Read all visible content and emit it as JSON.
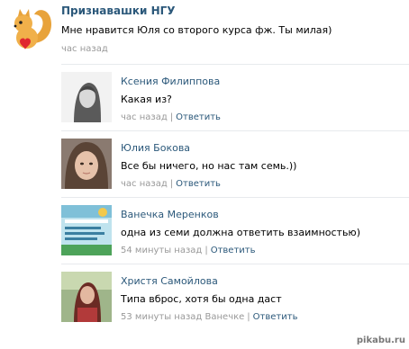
{
  "post": {
    "author": "Признавашки НГУ",
    "text": "Мне нравится Юля со второго курса фж. Ты милая)",
    "time": "час назад",
    "avatar_icon": "squirrel-heart-icon"
  },
  "comments": [
    {
      "name": "Ксения Филиппова",
      "text": "Какая из?",
      "time": "час назад",
      "reply_to": "",
      "reply": "Ответить",
      "avatar": "bw-photo"
    },
    {
      "name": "Юлия Бокова",
      "text": "Все бы ничего, но нас там семь.))",
      "time": "час назад",
      "reply_to": "",
      "reply": "Ответить",
      "avatar": "face-photo"
    },
    {
      "name": "Ванечка Меренков",
      "text": "одна из семи должна ответить взаимностью)",
      "time": "54 минуты назад",
      "reply_to": "",
      "reply": "Ответить",
      "avatar": "poster-photo"
    },
    {
      "name": "Христя Самойлова",
      "text": "Типа вброс, хотя бы одна даст",
      "time": "53 минуты назад",
      "reply_to": "Ванечке",
      "reply": "Ответить",
      "avatar": "outdoor-photo"
    }
  ],
  "watermark": "pikabu.ru"
}
